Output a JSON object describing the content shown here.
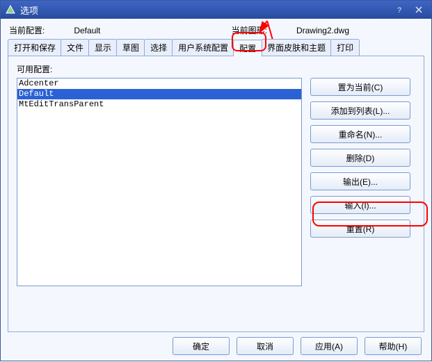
{
  "window": {
    "title": "选项"
  },
  "info": {
    "current_config_label": "当前配置:",
    "current_config_value": "Default",
    "current_drawing_label": "当前图形:",
    "current_drawing_value": "Drawing2.dwg"
  },
  "tabs": {
    "t0": "打开和保存",
    "t1": "文件",
    "t2": "显示",
    "t3": "草图",
    "t4": "选择",
    "t5": "用户系统配置",
    "t6": "配置",
    "t7": "界面皮肤和主题",
    "t8": "打印"
  },
  "panel": {
    "available_label": "可用配置:",
    "items": {
      "i0": "Adcenter",
      "i1": "Default",
      "i2": "MtEditTransParent"
    }
  },
  "buttons": {
    "set_current": "置为当前(C)",
    "add_to_list": "添加到列表(L)...",
    "rename": "重命名(N)...",
    "delete": "删除(D)",
    "export": "输出(E)...",
    "import": "输入(I)...",
    "reset": "重置(R)"
  },
  "footer": {
    "ok": "确定",
    "cancel": "取消",
    "apply": "应用(A)",
    "help": "帮助(H)"
  }
}
